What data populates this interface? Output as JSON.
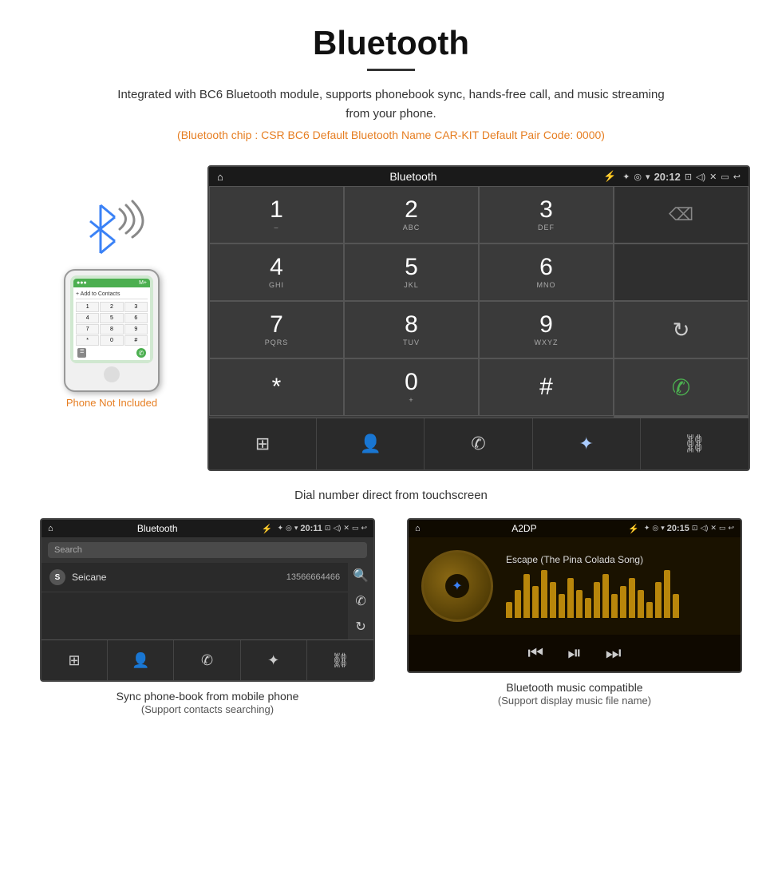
{
  "header": {
    "title": "Bluetooth",
    "description": "Integrated with BC6 Bluetooth module, supports phonebook sync, hands-free call, and music streaming from your phone.",
    "specs": "(Bluetooth chip : CSR BC6    Default Bluetooth Name CAR-KIT    Default Pair Code: 0000)"
  },
  "dialer": {
    "status_bar": {
      "home_icon": "⌂",
      "title": "Bluetooth",
      "usb_icon": "⚡",
      "bt_icon": "✦",
      "location_icon": "◎",
      "signal_icon": "▼",
      "time": "20:12",
      "camera_icon": "⊡",
      "volume_icon": "◁)",
      "close_icon": "✕",
      "window_icon": "▭",
      "back_icon": "↩"
    },
    "keys": [
      {
        "num": "1",
        "sub": "⌣",
        "col": 0
      },
      {
        "num": "2",
        "sub": "ABC",
        "col": 1
      },
      {
        "num": "3",
        "sub": "DEF",
        "col": 2
      },
      {
        "num": "",
        "sub": "",
        "col": 3,
        "empty": true
      },
      {
        "num": "4",
        "sub": "GHI",
        "col": 0
      },
      {
        "num": "5",
        "sub": "JKL",
        "col": 1
      },
      {
        "num": "6",
        "sub": "MNO",
        "col": 2
      },
      {
        "num": "",
        "sub": "",
        "col": 3,
        "empty": true
      },
      {
        "num": "7",
        "sub": "PQRS",
        "col": 0
      },
      {
        "num": "8",
        "sub": "TUV",
        "col": 1
      },
      {
        "num": "9",
        "sub": "WXYZ",
        "col": 2
      },
      {
        "num": "↻",
        "sub": "",
        "col": 3,
        "type": "refresh"
      },
      {
        "num": "*",
        "sub": "",
        "col": 0
      },
      {
        "num": "0",
        "sub": "+",
        "col": 1
      },
      {
        "num": "#",
        "sub": "",
        "col": 2
      },
      {
        "num": "✆",
        "sub": "",
        "col": 3,
        "type": "call-green"
      },
      {
        "num": "⌫",
        "sub": "",
        "col": 3,
        "type": "backspace",
        "row_special": true
      }
    ],
    "bottom_bar": {
      "items": [
        "⊞",
        "👤",
        "✆",
        "✦",
        "⛓"
      ]
    },
    "caption": "Dial number direct from touchscreen"
  },
  "phonebook": {
    "status_bar": {
      "home_icon": "⌂",
      "title": "Bluetooth",
      "usb_icon": "⚡",
      "bt_icon": "✦",
      "location_icon": "◎",
      "signal_icon": "▼",
      "time": "20:11",
      "camera_icon": "⊡",
      "volume_icon": "◁)",
      "close_icon": "✕",
      "window_icon": "▭",
      "back_icon": "↩"
    },
    "search_placeholder": "Search",
    "contacts": [
      {
        "letter": "S",
        "name": "Seicane",
        "number": "13566664466"
      }
    ],
    "right_icons": [
      "🔍",
      "✆",
      "↻"
    ],
    "bottom_bar": [
      "⊞",
      "👤",
      "✆",
      "✦",
      "⛓"
    ],
    "caption": "Sync phone-book from mobile phone",
    "caption_sub": "(Support contacts searching)"
  },
  "music": {
    "status_bar": {
      "home_icon": "⌂",
      "title": "A2DP",
      "usb_icon": "⚡",
      "bt_icon": "✦",
      "location_icon": "◎",
      "signal_icon": "▼",
      "time": "20:15",
      "camera_icon": "⊡",
      "volume_icon": "◁)",
      "close_icon": "✕",
      "window_icon": "▭",
      "back_icon": "↩"
    },
    "song_title": "Escape (The Pina Colada Song)",
    "bt_icon": "✦",
    "controls": {
      "prev": "⏮",
      "play_pause": "⏯",
      "next": "⏭"
    },
    "visualizer_bars": [
      20,
      35,
      55,
      40,
      60,
      45,
      30,
      50,
      35,
      25,
      45,
      55,
      30,
      40,
      50,
      35,
      20,
      45,
      60,
      30
    ],
    "caption": "Bluetooth music compatible",
    "caption_sub": "(Support display music file name)"
  },
  "phone_area": {
    "not_included": "Phone Not Included"
  }
}
